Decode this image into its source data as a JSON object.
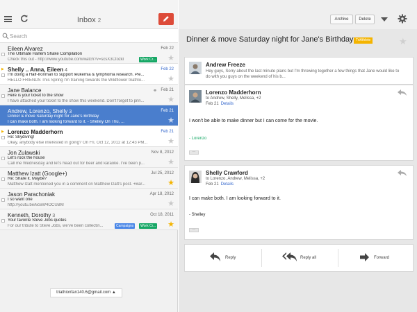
{
  "list": {
    "title": "Inbox",
    "count": "2",
    "search_placeholder": "Search",
    "account": "triathionfan140.6@gmail.com ▲",
    "messages": [
      {
        "sender": "Eileen Alvarez",
        "count": "",
        "date": "Feb 22",
        "subject": "The Ultimate Harlem Shake Compilation",
        "snippet": "Check this out - http://www.youtube.com/watch?v=scsX3Ctozkl",
        "label": "Work Cr...",
        "label2": "",
        "starred": false,
        "unread": false,
        "selected": false
      },
      {
        "sender": "Shelly .. Anna, Eileen",
        "count": "4",
        "date": "Feb 22",
        "subject": "I'm doing a Half-Ironman to support leukemia & lymphoma research. Ple...",
        "snippet": "HELLO FRIENDS This Spring I'm training towards the Wildflower triathlo...",
        "label": "",
        "label2": "",
        "starred": false,
        "unread": true,
        "selected": false
      },
      {
        "sender": "Jane Balance",
        "count": "",
        "date": "Feb 21",
        "subject": "Here is your ticket to the show",
        "snippet": "I have attached your ticket to the show this weekend. Don't forget to prin...",
        "label": "",
        "label2": "",
        "starred": false,
        "unread": false,
        "selected": false
      },
      {
        "sender": "Andrew, Lorenzo, Shelly",
        "count": "3",
        "date": "Feb 21",
        "subject": "Dinner & move Saturday night for Jane's Birthday",
        "snippet": "I can make both. I am looking forward to it. - Shelley On Thu, ...",
        "label": "",
        "label2": "",
        "starred": false,
        "unread": false,
        "selected": true
      },
      {
        "sender": "Lorenzo Madderhorn",
        "count": "",
        "date": "Feb 21",
        "subject": "Re: Skydiving!",
        "snippet": "Okay, anybody else interested in going? On Fri, Oct 12, 2012 at 12:43 PM...",
        "label": "",
        "label2": "",
        "starred": false,
        "unread": true,
        "selected": false
      },
      {
        "sender": "Jon Zulawski",
        "count": "",
        "date": "Nov 8, 2012",
        "subject": "Let's rock the house",
        "snippet": "Call me Wednesday and let's head out for beer and karaoke. I've been p...",
        "label": "",
        "label2": "",
        "starred": false,
        "unread": false,
        "selected": false
      },
      {
        "sender": "Matthew Izatt (Google+)",
        "count": "",
        "date": "Jul 25, 2012",
        "subject": "Re: Share it. Maybe?",
        "snippet": "Matthew Izatt mentioned you in a comment on Matthew Izatt's post. +Bar...",
        "label": "",
        "label2": "",
        "starred": true,
        "unread": false,
        "selected": false
      },
      {
        "sender": "Jason Parachoniak",
        "count": "",
        "date": "Apr 18, 2012",
        "subject": "I so want one",
        "snippet": "http://youtu.be/6c6W4OCUBM",
        "label": "",
        "label2": "",
        "starred": false,
        "unread": false,
        "selected": false
      },
      {
        "sender": "Kenneth, Dorothy",
        "count": "3",
        "date": "Oct 18, 2011",
        "subject": "Your favorite Steve Jobs quotes",
        "snippet": "For our tribute to Steve Jobs, we've been collectin...",
        "label": "Work Cr...",
        "label2": "Campaigns",
        "starred": true,
        "unread": false,
        "selected": false
      }
    ]
  },
  "toolbar": {
    "archive": "Archive",
    "delete": "Delete"
  },
  "thread": {
    "subject": "Dinner & move Saturday night for Jane's Birthday",
    "label": "TriAthlete",
    "messages": [
      {
        "sender": "Andrew Freeze",
        "snippet": "Hey guys, Sorry about the last minute plans but I'm throwing together a few things that Jane would like to do with you guys on the weekend of his b..."
      },
      {
        "sender": "Lorenzo Madderhorn",
        "recipients": "to Andrew, Shelly, Melissa, +2",
        "date": "Feb 21",
        "details": "Details",
        "body": "I won't be able to make dinner but I can come for the movie.",
        "signature": "- Lorenzo"
      },
      {
        "sender": "Shelly Crawford",
        "recipients": "to Lorenzo, Andrew, Melissa, +2",
        "date": "Feb 21",
        "details": "Details",
        "body": "I can make both. I am looking forward to it.",
        "signature": "- Shelley"
      }
    ]
  },
  "actions": {
    "reply": "Reply",
    "reply_all": "Reply all",
    "forward": "Forward"
  },
  "colors": {
    "compose": "#dd4b39",
    "selected_row": "#4a7ecd",
    "star": "#f4b400",
    "link": "#3366cc",
    "signature_green": "#16a765"
  }
}
